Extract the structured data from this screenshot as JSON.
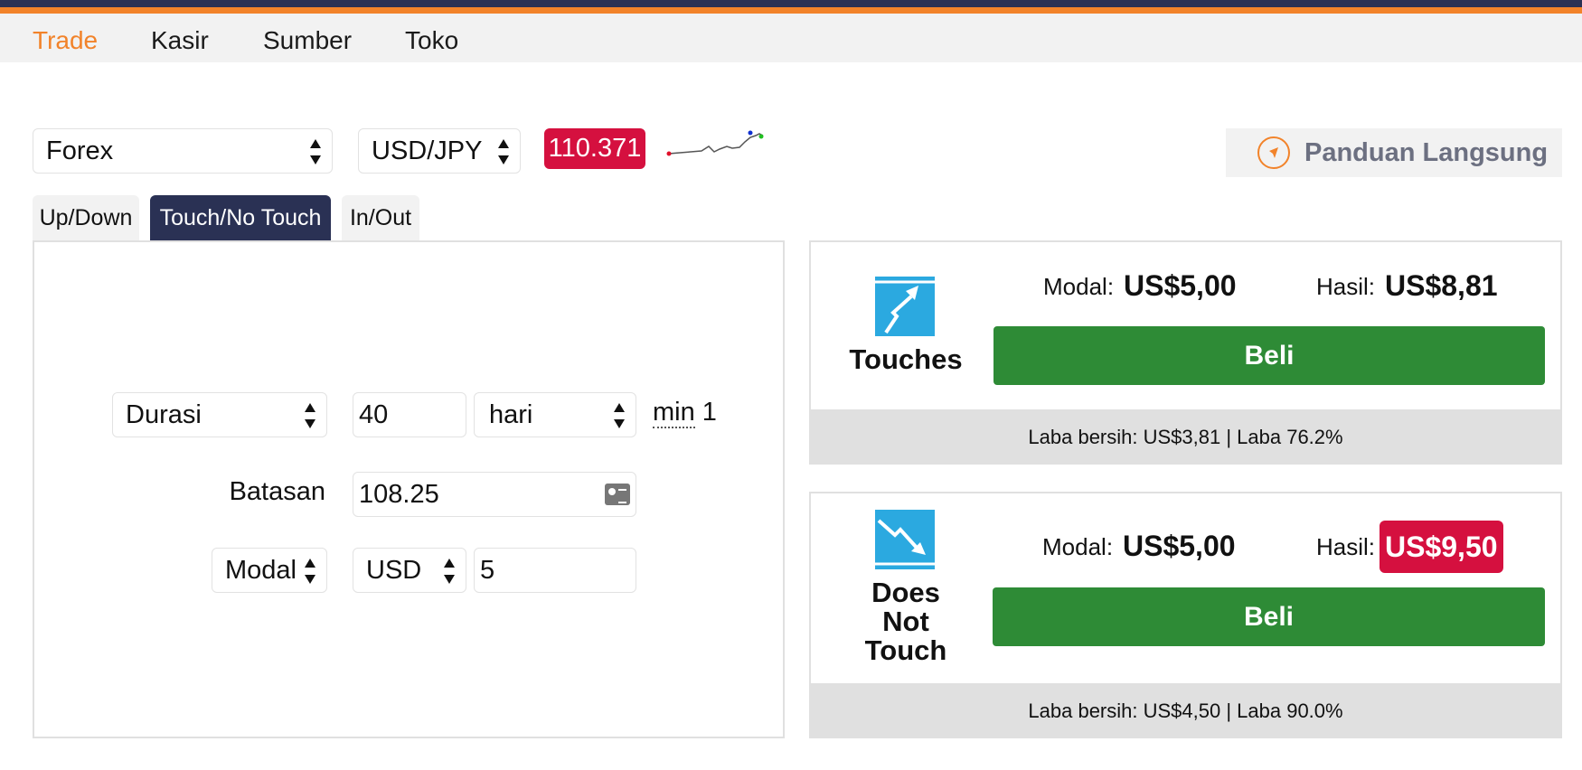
{
  "nav": {
    "items": [
      {
        "label": "Trade",
        "active": true
      },
      {
        "label": "Kasir",
        "active": false
      },
      {
        "label": "Sumber",
        "active": false
      },
      {
        "label": "Toko",
        "active": false
      }
    ]
  },
  "market": {
    "category": "Forex",
    "symbol": "USD/JPY",
    "price": "110.371"
  },
  "guide": {
    "label": "Panduan Langsung"
  },
  "tabs": [
    {
      "label": "Up/Down",
      "active": false
    },
    {
      "label": "Touch/No Touch",
      "active": true
    },
    {
      "label": "In/Out",
      "active": false
    }
  ],
  "form": {
    "duration_type": "Durasi",
    "duration_value": "40",
    "duration_unit": "hari",
    "duration_min_label": "min",
    "duration_min_value": "1",
    "barrier_label": "Batasan",
    "barrier_value": "108.25",
    "amount_type": "Modal",
    "currency": "USD",
    "amount_value": "5"
  },
  "contracts": [
    {
      "name": "Touches",
      "icon": "touches-icon",
      "stake_label": "Modal:",
      "stake_value": "US$5,00",
      "payout_label": "Hasil:",
      "payout_value": "US$8,81",
      "buy_label": "Beli",
      "footer": "Laba bersih: US$3,81 | Laba 76.2%"
    },
    {
      "name_lines": [
        "Does",
        "Not",
        "Touch"
      ],
      "icon": "does-not-touch-icon",
      "stake_label": "Modal:",
      "stake_value": "US$5,00",
      "payout_label": "Hasil:",
      "payout_value": "US$9,50",
      "buy_label": "Beli",
      "footer": "Laba bersih: US$4,50 | Laba 90.0%"
    }
  ],
  "colors": {
    "brand_dark": "#2a3154",
    "accent_orange": "#f2832a",
    "price_red": "#d5103f",
    "buy_green": "#2e8b36",
    "icon_blue": "#2ba9e0"
  }
}
